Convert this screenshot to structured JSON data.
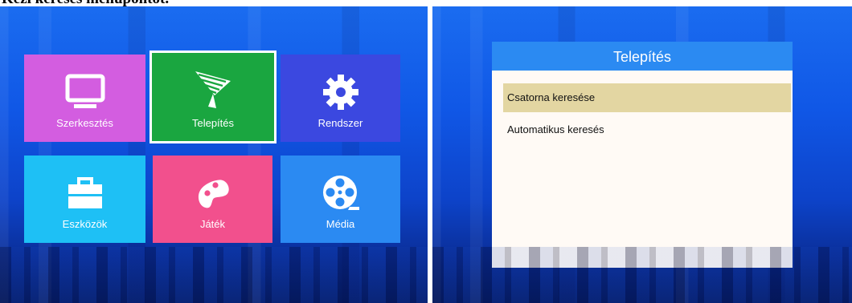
{
  "page_heading": "Kézi keresés menüpontot.",
  "main_menu": {
    "selected": "Telepítés",
    "tiles": [
      {
        "id": "szerkesztes",
        "label": "Szerkesztés",
        "icon": "tv-icon",
        "color": "#d35de0"
      },
      {
        "id": "telepites",
        "label": "Telepítés",
        "icon": "satellite-dish-icon",
        "color": "#1aa640"
      },
      {
        "id": "rendszer",
        "label": "Rendszer",
        "icon": "gear-icon",
        "color": "#3b48e0"
      },
      {
        "id": "eszkozok",
        "label": "Eszközök",
        "icon": "toolbox-icon",
        "color": "#1ec0f5"
      },
      {
        "id": "jatek",
        "label": "Játék",
        "icon": "gamepad-icon",
        "color": "#f2508d"
      },
      {
        "id": "media",
        "label": "Média",
        "icon": "film-reel-icon",
        "color": "#2b8af2"
      }
    ]
  },
  "install_dialog": {
    "title": "Telepítés",
    "header_color": "#2b8af2",
    "highlight_color": "#e3d6a2",
    "items": [
      {
        "label": "Csatorna keresése",
        "active": true
      },
      {
        "label": "Automatikus keresés",
        "active": false
      }
    ]
  }
}
